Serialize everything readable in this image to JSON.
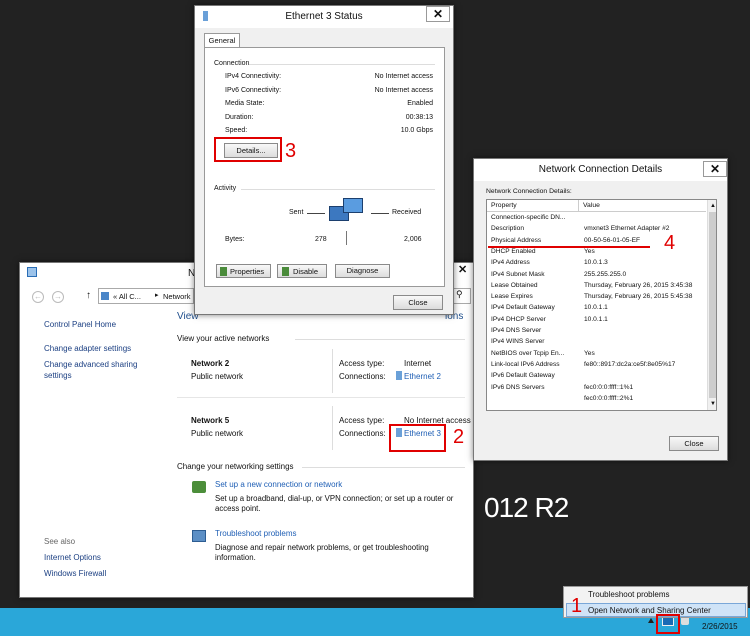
{
  "desktop": {
    "watermark": "012 R2"
  },
  "taskbar": {
    "date": "2/26/2015"
  },
  "tray_menu": {
    "items": [
      "Troubleshoot problems",
      "Open Network and Sharing Center"
    ]
  },
  "nsc": {
    "title_frag": "N",
    "address": {
      "left_frag": "« All C...",
      "right_frag": "Network"
    },
    "sidebar": {
      "home": "Control Panel Home",
      "links": [
        "Change adapter settings",
        "Change advanced sharing settings"
      ],
      "see_also": "See also",
      "see_links": [
        "Internet Options",
        "Windows Firewall"
      ]
    },
    "view_frag": "View",
    "view_frag2": "ions",
    "active_header": "View your active networks",
    "networks": [
      {
        "name": "Network 2",
        "type": "Public network",
        "access_label": "Access type:",
        "access": "Internet",
        "conn_label": "Connections:",
        "conn": "Ethernet 2"
      },
      {
        "name": "Network 5",
        "type": "Public network",
        "access_label": "Access type:",
        "access": "No Internet access",
        "conn_label": "Connections:",
        "conn": "Ethernet 3"
      }
    ],
    "change_header": "Change your networking settings",
    "tasks": [
      {
        "title": "Set up a new connection or network",
        "desc": "Set up a broadband, dial-up, or VPN connection; or set up a router or access point."
      },
      {
        "title": "Troubleshoot problems",
        "desc": "Diagnose and repair network problems, or get troubleshooting information."
      }
    ]
  },
  "status": {
    "title": "Ethernet 3 Status",
    "tab": "General",
    "connection_label": "Connection",
    "rows": [
      {
        "label": "IPv4 Connectivity:",
        "value": "No Internet access"
      },
      {
        "label": "IPv6 Connectivity:",
        "value": "No Internet access"
      },
      {
        "label": "Media State:",
        "value": "Enabled"
      },
      {
        "label": "Duration:",
        "value": "00:38:13"
      },
      {
        "label": "Speed:",
        "value": "10.0 Gbps"
      }
    ],
    "details_button": "Details...",
    "activity_label": "Activity",
    "sent": "Sent",
    "received": "Received",
    "bytes_label": "Bytes:",
    "bytes_sent": "278",
    "bytes_received": "2,006",
    "buttons": [
      "Properties",
      "Disable",
      "Diagnose"
    ],
    "close": "Close"
  },
  "details": {
    "title": "Network Connection Details",
    "caption": "Network Connection Details:",
    "headers": [
      "Property",
      "Value"
    ],
    "rows": [
      [
        "Connection-specific DN...",
        ""
      ],
      [
        "Description",
        "vmxnet3 Ethernet Adapter #2"
      ],
      [
        "Physical Address",
        "00-50-56-01-05-EF"
      ],
      [
        "DHCP Enabled",
        "Yes"
      ],
      [
        "IPv4 Address",
        "10.0.1.3"
      ],
      [
        "IPv4 Subnet Mask",
        "255.255.255.0"
      ],
      [
        "Lease Obtained",
        "Thursday, February 26, 2015 3:45:38"
      ],
      [
        "Lease Expires",
        "Thursday, February 26, 2015 5:45:38"
      ],
      [
        "IPv4 Default Gateway",
        "10.0.1.1"
      ],
      [
        "IPv4 DHCP Server",
        "10.0.1.1"
      ],
      [
        "IPv4 DNS Server",
        ""
      ],
      [
        "IPv4 WINS Server",
        ""
      ],
      [
        "NetBIOS over Tcpip En...",
        "Yes"
      ],
      [
        "Link-local IPv6 Address",
        "fe80::8917:dc2a:ce5f:8e05%17"
      ],
      [
        "IPv6 Default Gateway",
        ""
      ],
      [
        "IPv6 DNS Servers",
        "fec0:0:0:ffff::1%1"
      ],
      [
        "",
        "fec0:0:0:ffff::2%1"
      ]
    ],
    "close": "Close"
  },
  "annotations": [
    "1",
    "2",
    "3",
    "4"
  ]
}
